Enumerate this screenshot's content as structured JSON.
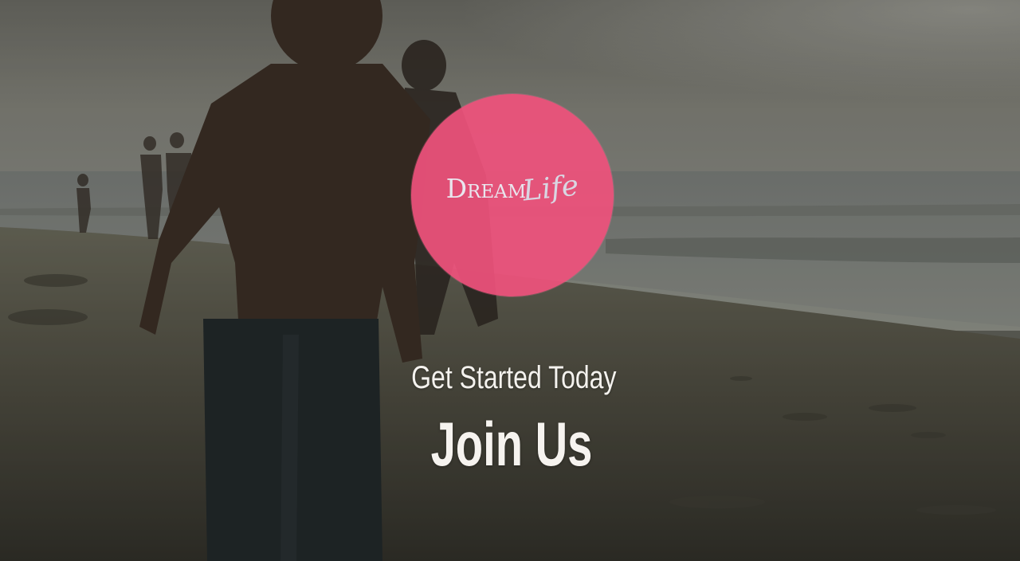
{
  "hero": {
    "background_image": "beach-runners-photo",
    "logo": {
      "word_main": "Dream",
      "word_script": "Life",
      "badge_color": "#ee527c"
    },
    "cta_subtitle": "Get Started Today",
    "cta_title": "Join Us"
  },
  "colors": {
    "badge": "#ee527c",
    "text": "#f6f3ef"
  }
}
